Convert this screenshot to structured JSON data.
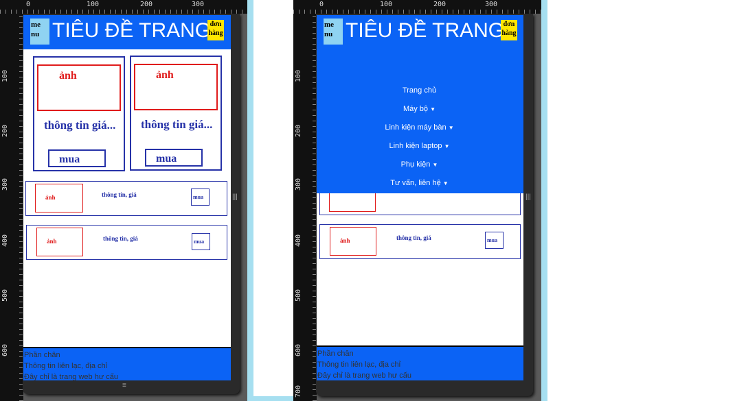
{
  "rulers": {
    "top": [
      "0",
      "100",
      "200",
      "300"
    ],
    "left": [
      "100",
      "200",
      "300",
      "400",
      "500",
      "600",
      "700"
    ]
  },
  "header": {
    "menu_label": "me nu",
    "title": "TIÊU ĐỀ TRANG",
    "orders_label": "đơn hàng"
  },
  "cards": [
    {
      "image": "ảnh",
      "info": "thông tin giá...",
      "buy": "mua"
    },
    {
      "image": "ảnh",
      "info": "thông tin giá...",
      "buy": "mua"
    }
  ],
  "rows": [
    {
      "image": "ảnh",
      "info": "thông tin, giá",
      "buy": "mua"
    },
    {
      "image": "ảnh",
      "info": "thông tin, giá",
      "buy": "mua"
    }
  ],
  "nav_menu": [
    {
      "label": "Trang chủ",
      "dropdown": false
    },
    {
      "label": "Máy bộ",
      "dropdown": true
    },
    {
      "label": "Linh kiện máy bàn",
      "dropdown": true
    },
    {
      "label": "Linh kiện laptop",
      "dropdown": true
    },
    {
      "label": "Phụ kiện",
      "dropdown": true
    },
    {
      "label": "Tư vấn, liên hệ",
      "dropdown": true
    }
  ],
  "footer": {
    "line1": "Phần chân",
    "line2": "Thông tin liên lạc, địa chỉ",
    "line3": "Đây chỉ là trang web hư cấu"
  },
  "colors": {
    "header_bg": "#0b63f5",
    "menu_button_bg": "#8fd3f2",
    "orders_bg": "#ffe600",
    "image_border": "#e01b1b",
    "card_border": "#2632a8",
    "divider": "#a6dff0"
  },
  "icons": {
    "caret": "triangle-down",
    "resize_handle": "three-lines"
  }
}
